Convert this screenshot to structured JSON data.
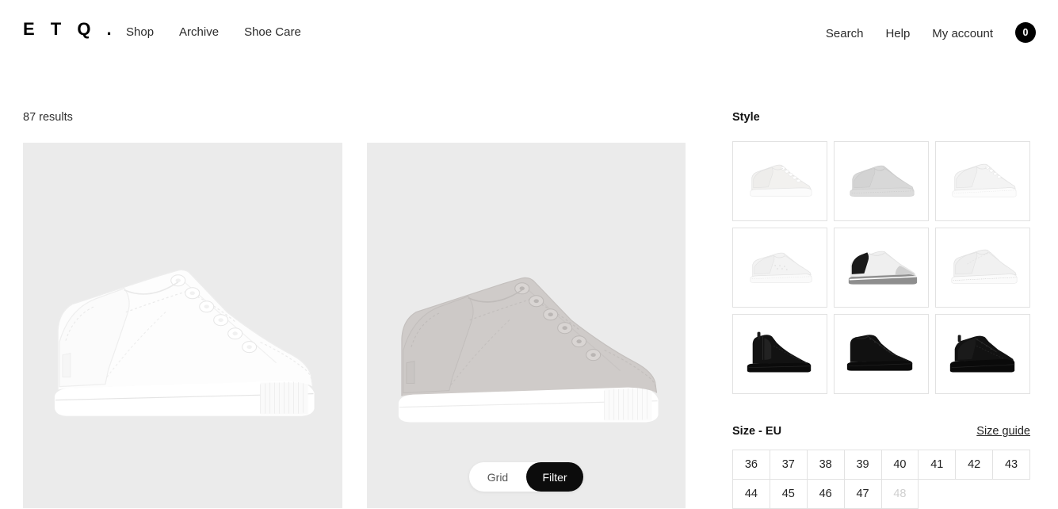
{
  "header": {
    "logo": "E T Q .",
    "nav_left": [
      {
        "label": "Shop"
      },
      {
        "label": "Archive"
      },
      {
        "label": "Shoe Care"
      }
    ],
    "nav_right": [
      {
        "label": "Search"
      },
      {
        "label": "Help"
      },
      {
        "label": "My account"
      }
    ],
    "cart_count": "0"
  },
  "listing": {
    "results_text": "87 results",
    "products": [
      {
        "name": "white-leather-low-top-sneaker",
        "body_color": "#fdfdfd",
        "sole_color": "#ffffff",
        "bg": "#ebebeb"
      },
      {
        "name": "grey-suede-low-top-sneaker",
        "body_color": "#cfcbc9",
        "sole_color": "#ffffff",
        "bg": "#ebebeb"
      }
    ]
  },
  "view_toggle": {
    "grid_label": "Grid",
    "filter_label": "Filter",
    "active": "Filter"
  },
  "filters": {
    "style": {
      "title": "Style",
      "tiles": [
        {
          "name": "low-top-white-leather",
          "body": "#f2f1ef",
          "sole": "#fbfbfb",
          "type": "low"
        },
        {
          "name": "low-top-grey-suede",
          "body": "#d8d8d8",
          "sole": "#e6e6e6",
          "type": "low"
        },
        {
          "name": "low-top-white-smooth",
          "body": "#f4f4f4",
          "sole": "#fcfcfc",
          "type": "low"
        },
        {
          "name": "low-top-white-perforated",
          "body": "#f3f3f3",
          "sole": "#fafafa",
          "type": "low"
        },
        {
          "name": "low-top-white-grey-heel",
          "body": "#efefef",
          "sole": "#8e8e8e",
          "type": "low"
        },
        {
          "name": "low-top-white-textured",
          "body": "#f1f1f1",
          "sole": "#f8f8f8",
          "type": "low"
        },
        {
          "name": "chelsea-boot-black",
          "body": "#101010",
          "sole": "#0a0a0a",
          "type": "chelsea"
        },
        {
          "name": "mid-top-boot-black",
          "body": "#111111",
          "sole": "#0a0a0a",
          "type": "mid"
        },
        {
          "name": "derby-shoe-black",
          "body": "#121212",
          "sole": "#0a0a0a",
          "type": "derby"
        }
      ]
    },
    "size": {
      "title": "Size - EU",
      "guide_label": "Size guide",
      "options": [
        {
          "label": "36",
          "disabled": false
        },
        {
          "label": "37",
          "disabled": false
        },
        {
          "label": "38",
          "disabled": false
        },
        {
          "label": "39",
          "disabled": false
        },
        {
          "label": "40",
          "disabled": false
        },
        {
          "label": "41",
          "disabled": false
        },
        {
          "label": "42",
          "disabled": false
        },
        {
          "label": "43",
          "disabled": false
        },
        {
          "label": "44",
          "disabled": false
        },
        {
          "label": "45",
          "disabled": false
        },
        {
          "label": "46",
          "disabled": false
        },
        {
          "label": "47",
          "disabled": false
        },
        {
          "label": "48",
          "disabled": true
        }
      ]
    }
  },
  "colors": {
    "accent": "#000000",
    "panel_border": "#e2e2e2",
    "product_bg": "#ebebeb",
    "text": "#1a1a1a"
  }
}
